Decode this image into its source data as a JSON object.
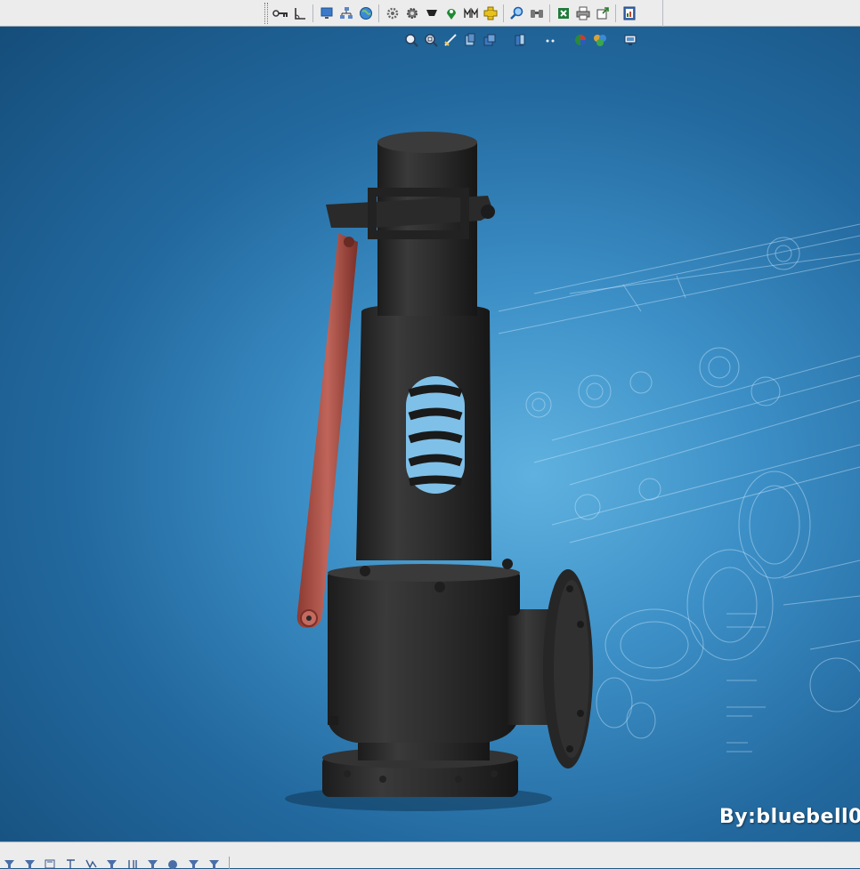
{
  "top_toolbar": {
    "buttons": [
      {
        "icon": "key-icon",
        "group": 1
      },
      {
        "icon": "angle-icon",
        "group": 1
      },
      {
        "icon": "monitor-icon",
        "group": 2
      },
      {
        "icon": "network-icon",
        "group": 2
      },
      {
        "icon": "globe-icon",
        "group": 2
      },
      {
        "icon": "settings-gear-icon",
        "group": 3
      },
      {
        "icon": "cog-icon",
        "group": 3
      },
      {
        "icon": "funnel-icon",
        "group": 3
      },
      {
        "icon": "location-pin-icon",
        "group": 3
      },
      {
        "icon": "bars-icon",
        "group": 3
      },
      {
        "icon": "add-part-icon",
        "group": 3
      },
      {
        "icon": "magnifier-icon",
        "group": 4
      },
      {
        "icon": "binoculars-icon",
        "group": 4
      },
      {
        "icon": "excel-icon",
        "group": 5
      },
      {
        "icon": "print-icon",
        "group": 5
      },
      {
        "icon": "export-icon",
        "group": 5
      },
      {
        "icon": "help-icon",
        "group": 6
      }
    ]
  },
  "view_toolbar": {
    "buttons": [
      {
        "icon": "zoom-to-fit-icon"
      },
      {
        "icon": "zoom-to-area-icon"
      },
      {
        "icon": "section-view-icon"
      },
      {
        "icon": "view-orientation-icon"
      },
      {
        "icon": "display-style-icon"
      },
      {
        "icon": "hide-show-icon"
      },
      {
        "icon": "view-setting-icon"
      },
      {
        "icon": "appearance-icon"
      },
      {
        "icon": "scene-icon"
      },
      {
        "icon": "monitor-settings-icon"
      }
    ]
  },
  "viewport": {
    "model": "safety-relief-valve",
    "background_color": "#2f7fb8",
    "body_color": "#2b2b2b",
    "lever_color": "#b55a4e",
    "watermark": "By:bluebell0"
  },
  "bottom_toolbar": {
    "buttons": [
      {
        "icon": "filter-1-icon"
      },
      {
        "icon": "filter-2-icon"
      },
      {
        "icon": "filter-3-icon"
      },
      {
        "icon": "filter-4-icon"
      },
      {
        "icon": "filter-5-icon"
      },
      {
        "icon": "filter-6-icon"
      },
      {
        "icon": "filter-7-icon"
      },
      {
        "icon": "filter-8-icon"
      },
      {
        "icon": "filter-9-icon"
      },
      {
        "icon": "filter-10-icon"
      },
      {
        "icon": "filter-11-icon"
      }
    ]
  }
}
